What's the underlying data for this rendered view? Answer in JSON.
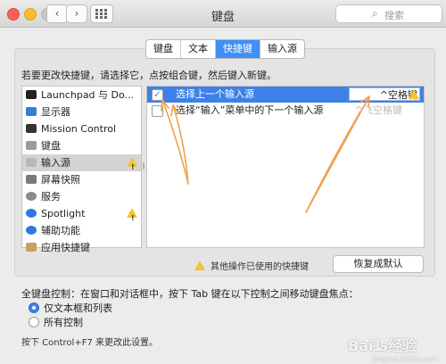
{
  "window": {
    "title": "键盘"
  },
  "toolbar": {
    "back": "‹",
    "forward": "›",
    "search_placeholder": "搜索"
  },
  "tabs": [
    {
      "label": "键盘",
      "active": false
    },
    {
      "label": "文本",
      "active": false
    },
    {
      "label": "快捷键",
      "active": true
    },
    {
      "label": "输入源",
      "active": false
    }
  ],
  "instruction": "若要更改快捷键，请选择它，点按组合键，然后键入新键。",
  "categories": [
    {
      "label": "Launchpad 与 Do...",
      "icon": "launchpad-icon",
      "color": "#222222",
      "warning": false,
      "selected": false
    },
    {
      "label": "显示器",
      "icon": "display-icon",
      "color": "#3a7bd5",
      "warning": false,
      "selected": false
    },
    {
      "label": "Mission Control",
      "icon": "mission-control-icon",
      "color": "#333333",
      "warning": false,
      "selected": false
    },
    {
      "label": "键盘",
      "icon": "keyboard-icon",
      "color": "#9a9a9a",
      "warning": false,
      "selected": false
    },
    {
      "label": "输入源",
      "icon": "input-source-icon",
      "color": "#b8b8b8",
      "warning": true,
      "selected": true
    },
    {
      "label": "屏幕快照",
      "icon": "screenshot-icon",
      "color": "#7a7a7a",
      "warning": false,
      "selected": false
    },
    {
      "label": "服务",
      "icon": "services-gear-icon",
      "color": "#8a8a8a",
      "warning": false,
      "selected": false
    },
    {
      "label": "Spotlight",
      "icon": "spotlight-icon",
      "color": "#2d7ae0",
      "warning": true,
      "selected": false
    },
    {
      "label": "辅助功能",
      "icon": "accessibility-icon",
      "color": "#2d7ae0",
      "warning": false,
      "selected": false
    },
    {
      "label": "应用快捷键",
      "icon": "app-shortcuts-icon",
      "color": "#c8a060",
      "warning": false,
      "selected": false
    }
  ],
  "shortcuts": [
    {
      "label": "选择上一个输入源",
      "key": "^空格键",
      "checked": true,
      "selected": true,
      "warning": true
    },
    {
      "label": "选择“输入”菜单中的下一个输入源",
      "key": "^飞空格键",
      "checked": false,
      "selected": false,
      "warning": false
    }
  ],
  "conflict_note": "其他操作已使用的快捷键",
  "restore_button": "恢复成默认",
  "keyboard_control": {
    "label": "全键盘控制：在窗口和对话框中，按下 Tab 键在以下控制之间移动键盘焦点：",
    "options": [
      {
        "label": "仅文本框和列表",
        "selected": true
      },
      {
        "label": "所有控制",
        "selected": false
      }
    ]
  },
  "hint": "按下 Control+F7 来更改此设置。",
  "watermark": {
    "text": "Baiط经验",
    "sub": "jingyan.baidu.com"
  },
  "colors": {
    "accent": "#3d81e8",
    "warning": "#f3c536",
    "annotation_arrow": "#f0a050"
  }
}
